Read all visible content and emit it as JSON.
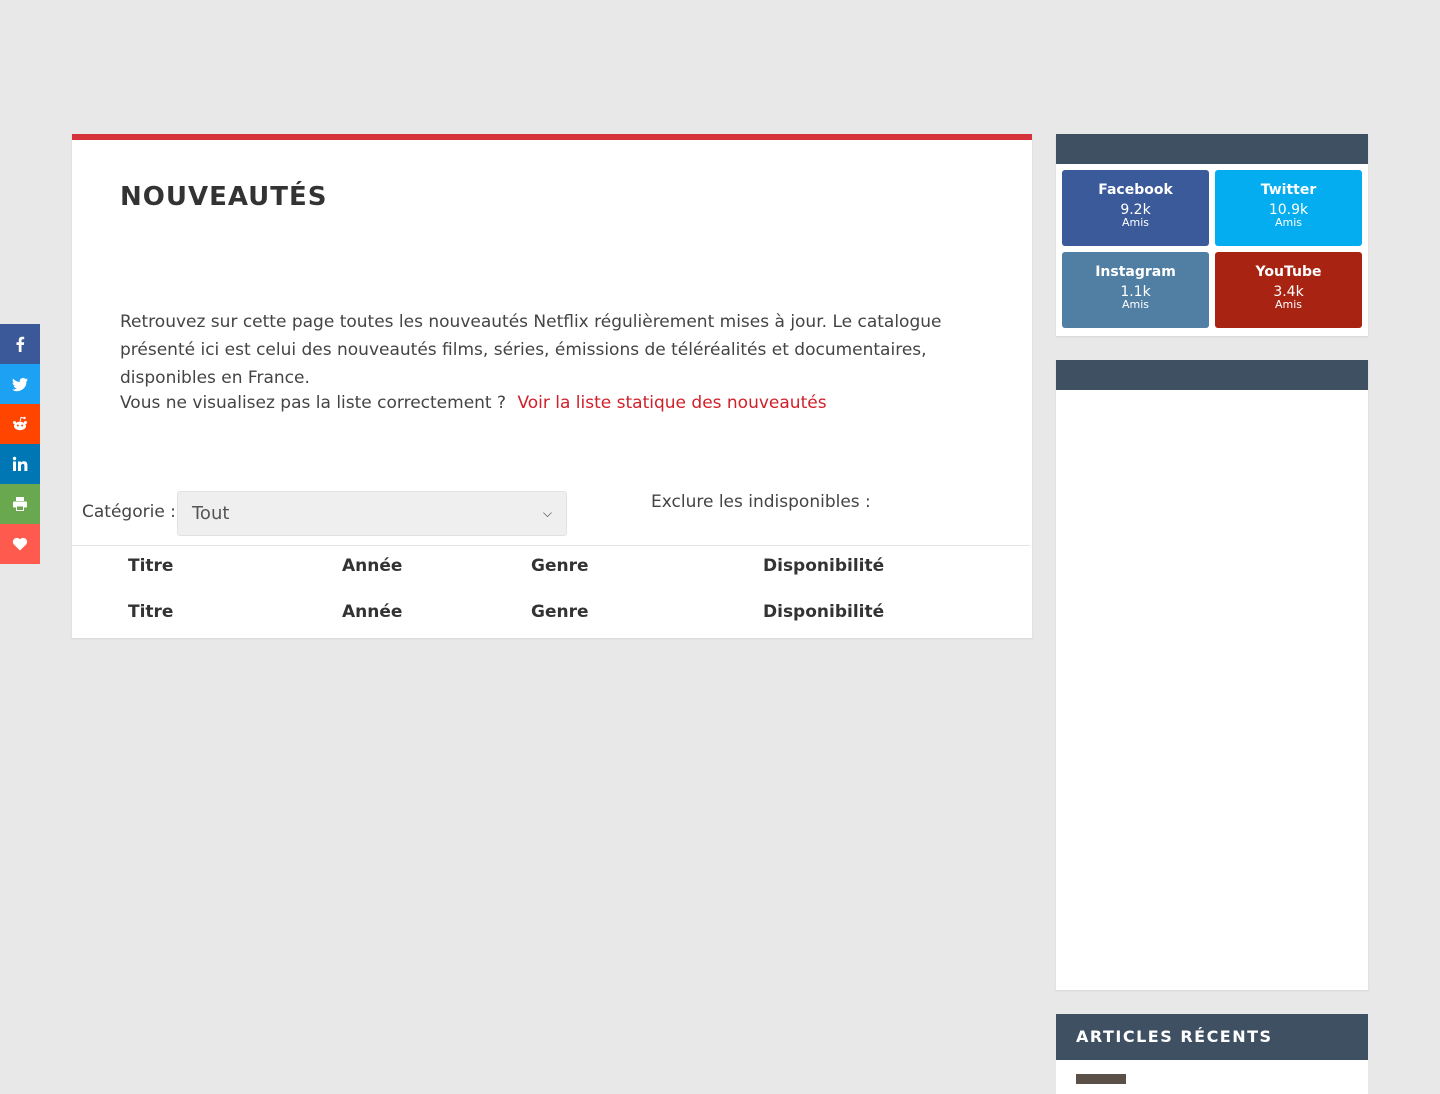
{
  "share_bar": {
    "items": [
      {
        "name": "facebook",
        "icon": "facebook-icon",
        "color": "#3b5998"
      },
      {
        "name": "twitter",
        "icon": "twitter-icon",
        "color": "#1da1f2"
      },
      {
        "name": "reddit",
        "icon": "reddit-icon",
        "color": "#ff4500"
      },
      {
        "name": "linkedin",
        "icon": "linkedin-icon",
        "color": "#0077b5"
      },
      {
        "name": "print",
        "icon": "print-icon",
        "color": "#6aa84f"
      },
      {
        "name": "love",
        "icon": "heart-icon",
        "color": "#ff5a4e"
      }
    ]
  },
  "main": {
    "title": "NOUVEAUTÉS",
    "intro": "Retrouvez sur cette page toutes les nouveautés Netflix régulièrement mises à jour. Le catalogue présenté ici est celui des nouveautés films, séries, émissions de téléréalités et documentaires, disponibles en France.",
    "static_prompt": "Vous ne visualisez pas la liste correctement ?",
    "static_link": "Voir la liste statique des nouveautés",
    "accent_color": "#d6323a",
    "filter": {
      "category_label": "Catégorie :",
      "category_value": "Tout",
      "exclude_label": "Exclure les indisponibles :"
    },
    "table": {
      "header": [
        "Titre",
        "Année",
        "Genre",
        "Disponibilité"
      ],
      "footer": [
        "Titre",
        "Année",
        "Genre",
        "Disponibilité"
      ]
    }
  },
  "sidebar": {
    "social": [
      {
        "name": "Facebook",
        "count": "9.2k",
        "unit": "Amis",
        "color": "#3b5a9a"
      },
      {
        "name": "Twitter",
        "count": "10.9k",
        "unit": "Amis",
        "color": "#03adef"
      },
      {
        "name": "Instagram",
        "count": "1.1k",
        "unit": "Amis",
        "color": "#517fa4"
      },
      {
        "name": "YouTube",
        "count": "3.4k",
        "unit": "Amis",
        "color": "#a82311"
      }
    ],
    "articles_title": "ARTICLES RÉCENTS"
  }
}
